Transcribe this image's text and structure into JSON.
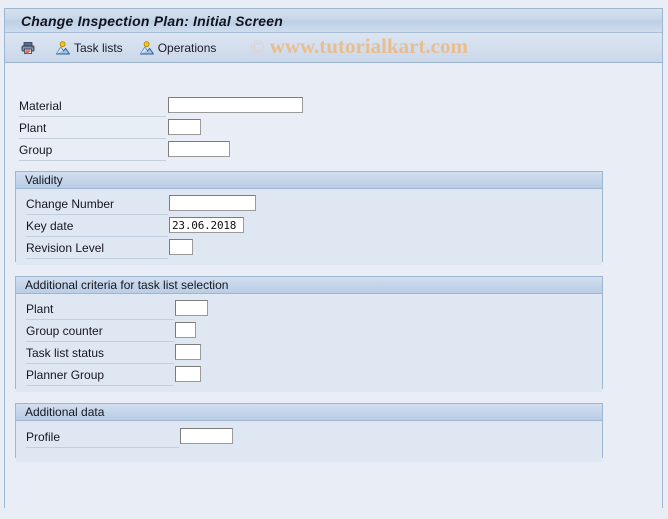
{
  "window": {
    "title": "Change Inspection Plan: Initial Screen"
  },
  "watermark": {
    "copyright": "©",
    "text": "www.tutorialkart.com"
  },
  "toolbar": {
    "buttons": [
      {
        "name": "print-preview",
        "label": "",
        "icon": "printer-icon"
      },
      {
        "name": "task-lists",
        "label": "Task lists",
        "icon": "task-list-icon"
      },
      {
        "name": "operations",
        "label": "Operations",
        "icon": "operations-icon"
      }
    ]
  },
  "main_fields": [
    {
      "label": "Material",
      "value": "",
      "placeholder": ""
    },
    {
      "label": "Plant",
      "value": "",
      "placeholder": ""
    },
    {
      "label": "Group",
      "value": "",
      "placeholder": ""
    }
  ],
  "groups": [
    {
      "title": "Validity",
      "fields": [
        {
          "label": "Change Number",
          "value": "",
          "placeholder": ""
        },
        {
          "label": "Key date",
          "value": "23.06.2018",
          "placeholder": ""
        },
        {
          "label": "Revision Level",
          "value": "",
          "placeholder": ""
        }
      ]
    },
    {
      "title": "Additional criteria for task list selection",
      "fields": [
        {
          "label": "Plant",
          "value": "",
          "placeholder": ""
        },
        {
          "label": "Group counter",
          "value": "",
          "placeholder": ""
        },
        {
          "label": "Task list status",
          "value": "",
          "placeholder": ""
        },
        {
          "label": "Planner Group",
          "value": "",
          "placeholder": ""
        }
      ]
    },
    {
      "title": "Additional data",
      "fields": [
        {
          "label": "Profile",
          "value": "",
          "placeholder": ""
        }
      ]
    }
  ],
  "colors": {
    "background": "#e9eef6",
    "group_bg": "#dfe8f2",
    "border": "#9fb6d0",
    "title_text": "#13131f",
    "watermark": "#ecb87f",
    "field_bg": "#ffffff"
  }
}
